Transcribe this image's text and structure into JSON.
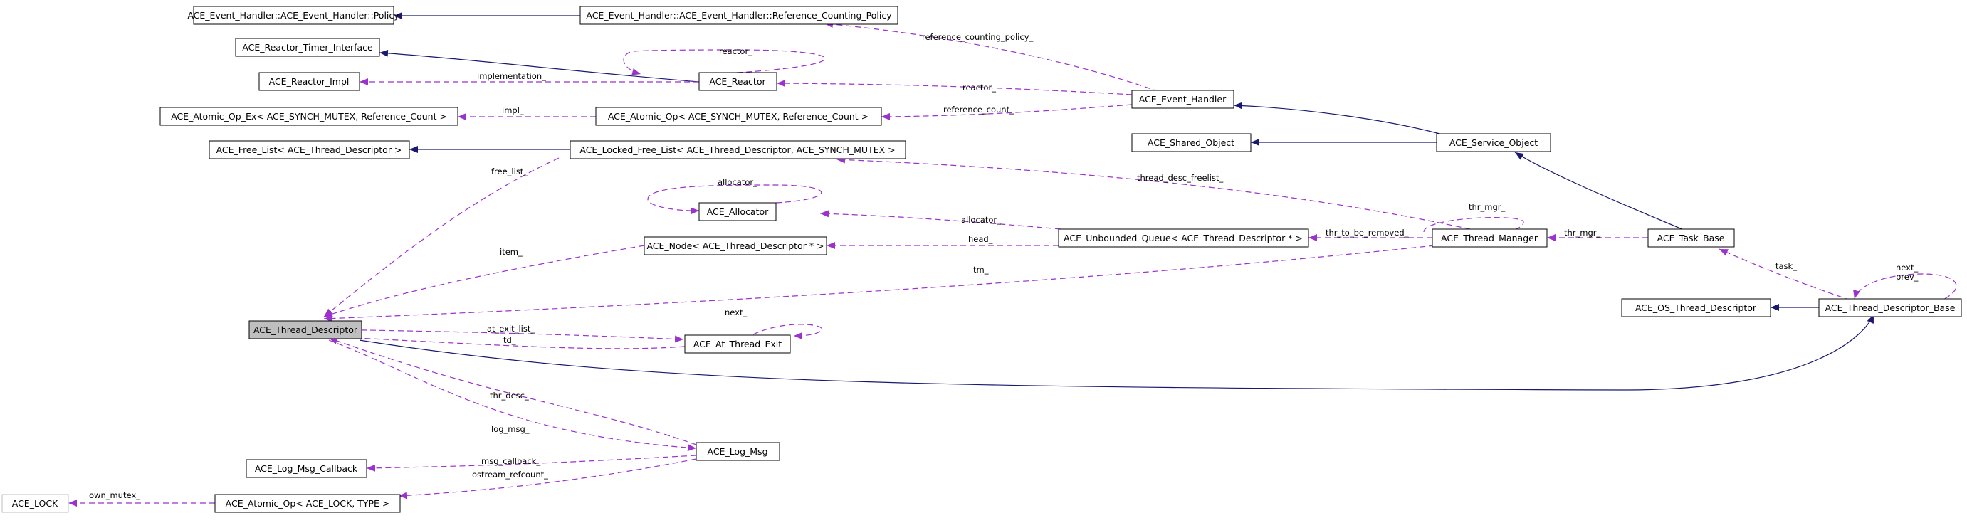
{
  "nodes": {
    "policy": "ACE_Event_Handler::ACE_Event_Handler::Policy",
    "ref_counting_policy": "ACE_Event_Handler::ACE_Event_Handler::Reference_Counting_Policy",
    "reactor_timer_interface": "ACE_Reactor_Timer_Interface",
    "reactor_impl": "ACE_Reactor_Impl",
    "reactor": "ACE_Reactor",
    "event_handler": "ACE_Event_Handler",
    "atomic_op_ex": "ACE_Atomic_Op_Ex< ACE_SYNCH_MUTEX, Reference_Count >",
    "atomic_op": "ACE_Atomic_Op< ACE_SYNCH_MUTEX, Reference_Count >",
    "shared_object": "ACE_Shared_Object",
    "service_object": "ACE_Service_Object",
    "free_list": "ACE_Free_List< ACE_Thread_Descriptor >",
    "locked_free_list": "ACE_Locked_Free_List< ACE_Thread_Descriptor, ACE_SYNCH_MUTEX >",
    "allocator": "ACE_Allocator",
    "node": "ACE_Node< ACE_Thread_Descriptor * >",
    "unbounded_queue": "ACE_Unbounded_Queue< ACE_Thread_Descriptor * >",
    "thread_manager": "ACE_Thread_Manager",
    "task_base": "ACE_Task_Base",
    "os_thread_descriptor": "ACE_OS_Thread_Descriptor",
    "thread_descriptor_base": "ACE_Thread_Descriptor_Base",
    "thread_descriptor": "ACE_Thread_Descriptor",
    "at_thread_exit": "ACE_At_Thread_Exit",
    "log_msg": "ACE_Log_Msg",
    "log_msg_callback": "ACE_Log_Msg_Callback",
    "ace_lock": "ACE_LOCK",
    "atomic_op_lock": "ACE_Atomic_Op< ACE_LOCK, TYPE >"
  },
  "edge_labels": {
    "reference_counting_policy": "reference_counting_policy_",
    "reactor_self": "reactor_",
    "implementation": "implementation_",
    "reactor": "reactor_",
    "impl": "impl_",
    "reference_count": "reference_count_",
    "thread_desc_freelist": "thread_desc_freelist_",
    "free_list": "free_list_",
    "allocator_self": "allocator_",
    "allocator": "allocator_",
    "thr_mgr_self": "thr_mgr_",
    "head": "head_",
    "thr_to_be_removed": "thr_to_be_removed_",
    "thr_mgr": "thr_mgr_",
    "item": "item_",
    "tm": "tm_",
    "task": "task_",
    "next": "next_",
    "prev": "prev_",
    "at_exit_list": "at_exit_list_",
    "td": "td_",
    "next_exit": "next_",
    "thr_desc": "thr_desc_",
    "log_msg": "log_msg_",
    "msg_callback": "msg_callback_",
    "ostream_refcount": "ostream_refcount_",
    "own_mutex": "own_mutex_"
  },
  "colors": {
    "inheritance_edge": "#191970",
    "collaboration_edge": "#9a32cd",
    "highlight_fill": "#bfbfbf",
    "box_border": "#000000",
    "undocumented_border": "#bfbfbf"
  }
}
